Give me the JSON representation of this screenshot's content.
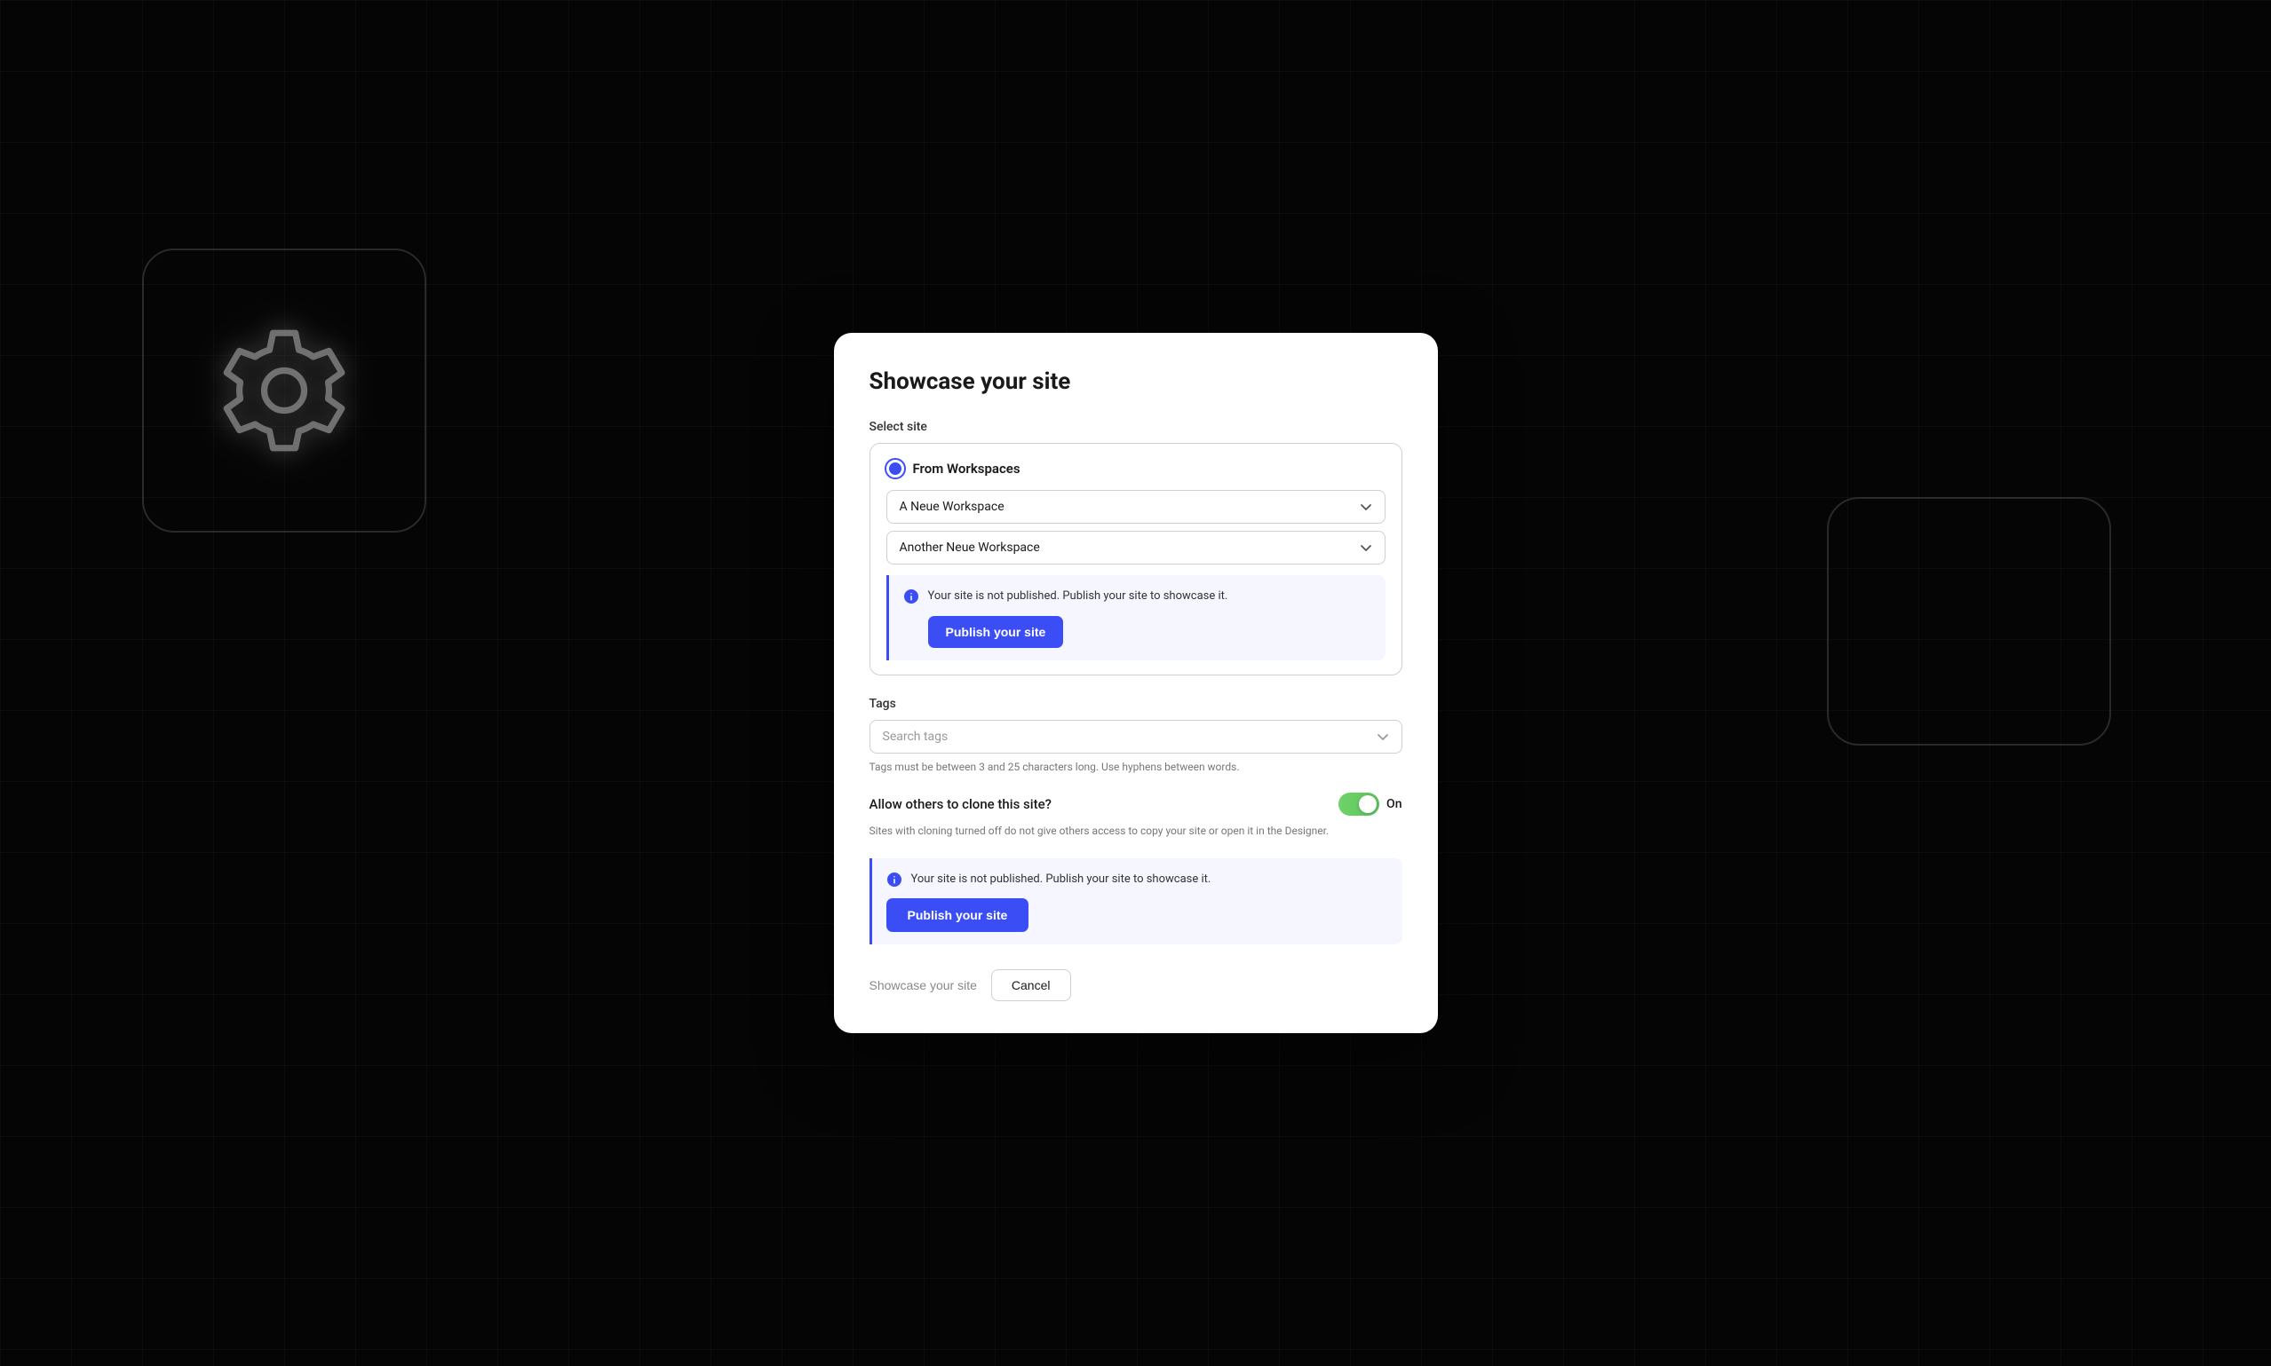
{
  "background": {
    "gridColor": "rgba(255,255,255,0.06)"
  },
  "modal": {
    "title": "Showcase your site",
    "selectSiteLabel": "Select site",
    "fromWorkspacesLabel": "From Workspaces",
    "workspace1": "A Neue Workspace",
    "workspace2": "Another Neue Workspace",
    "publishWarningText": "Your site is not published. Publish your site to showcase it.",
    "publishBtnSmLabel": "Publish your site",
    "tagsLabel": "Tags",
    "searchTagsPlaceholder": "Search tags",
    "tagsHint": "Tags must be between 3 and 25 characters long. Use hyphens between words.",
    "cloneLabel": "Allow others to clone this site?",
    "toggleState": "On",
    "cloneDesc": "Sites with cloning turned off do not give others access to copy your site or open it in the Designer.",
    "publishWarningText2": "Your site is not published. Publish your site to showcase it.",
    "publishBtnLgLabel": "Publish your site",
    "footerShowcaseLabel": "Showcase your site",
    "footerCancelLabel": "Cancel"
  }
}
